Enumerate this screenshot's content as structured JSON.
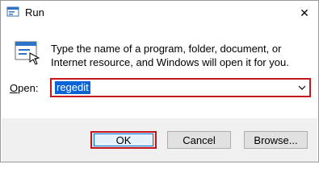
{
  "window": {
    "title": "Run",
    "icon": "run-app-icon",
    "close_glyph": "✕"
  },
  "body": {
    "description": "Type the name of a program, folder, document, or Internet resource, and Windows will open it for you.",
    "open_label_accel": "O",
    "open_label_rest": "pen:",
    "open_value": "regedit"
  },
  "buttons": {
    "ok": "OK",
    "cancel": "Cancel",
    "browse": "Browse..."
  },
  "colors": {
    "highlight_border": "#c5161d",
    "selection": "#0a64d6"
  }
}
